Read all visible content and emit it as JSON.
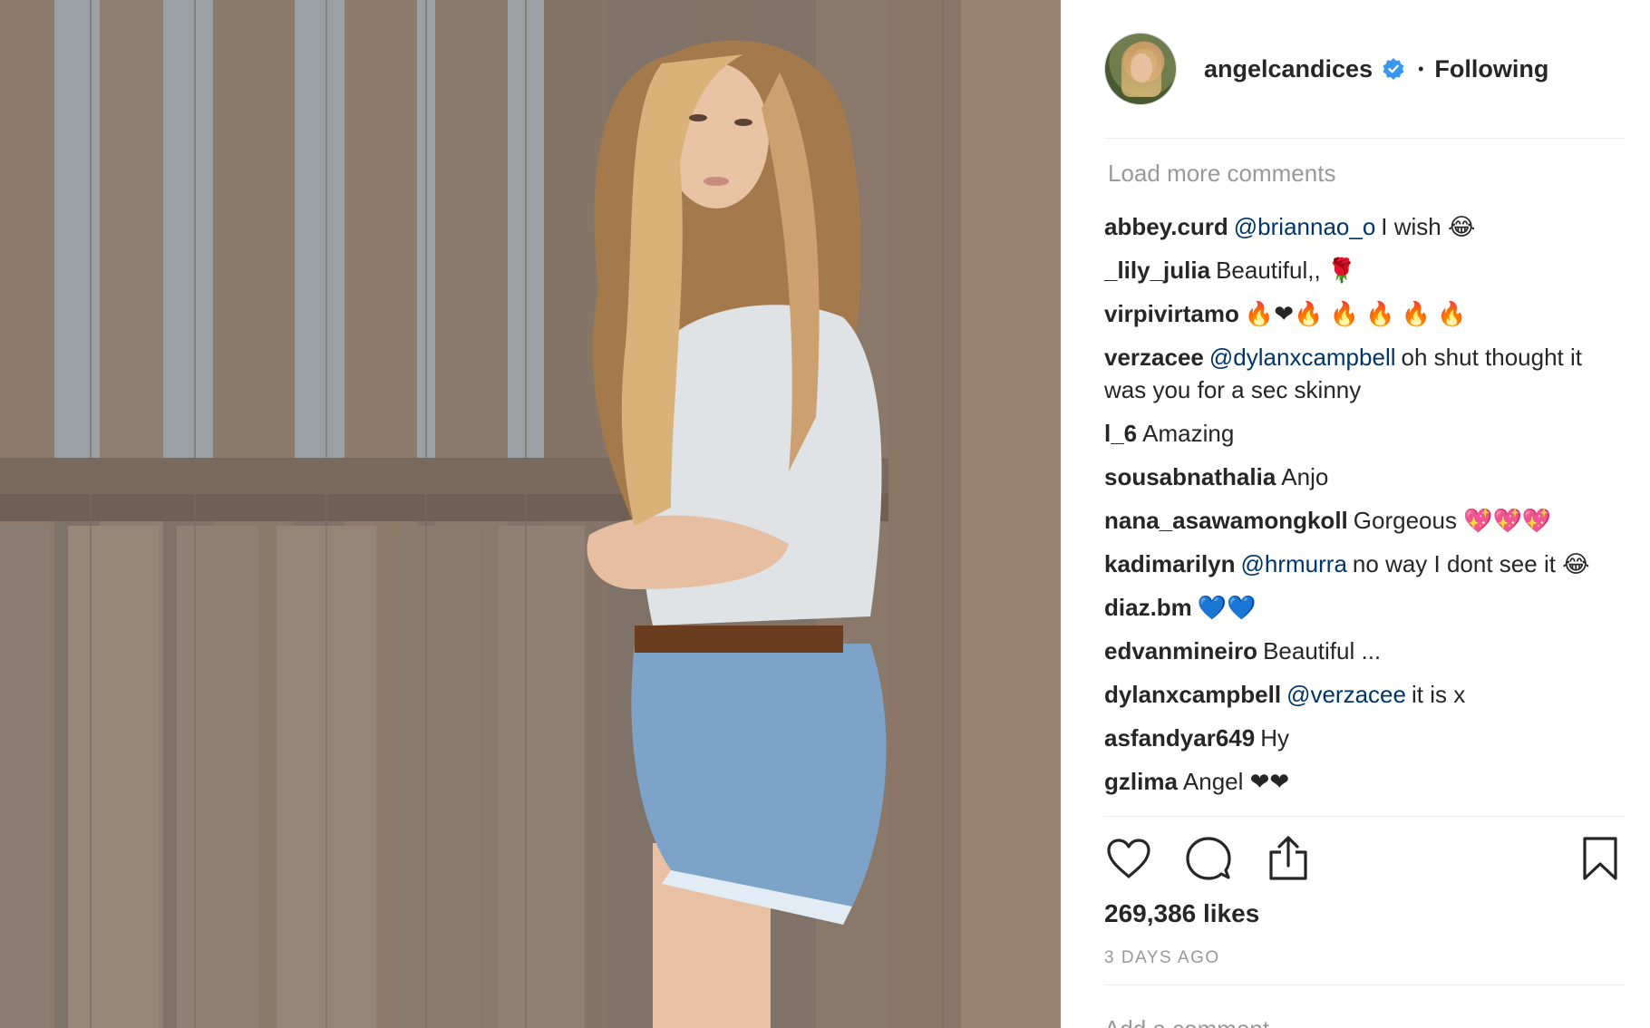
{
  "post": {
    "username": "angelcandices",
    "separator": "•",
    "follow_status": "Following",
    "load_more": "Load more comments",
    "likes": "269,386 likes",
    "time_ago": "3 DAYS AGO",
    "add_comment_placeholder": "Add a comment..."
  },
  "comments": [
    {
      "user": "abbey.curd",
      "mention": "@briannao_o",
      "text": "I wish 😂"
    },
    {
      "user": "_lily_julia",
      "mention": "",
      "text": "Beautiful,, 🌹"
    },
    {
      "user": "virpivirtamo",
      "mention": "",
      "text": "🔥❤🔥 🔥 🔥 🔥 🔥"
    },
    {
      "user": "verzacee",
      "mention": "@dylanxcampbell",
      "text": "oh shut thought it was you for a sec skinny"
    },
    {
      "user": "l_6",
      "mention": "",
      "text": "Amazing"
    },
    {
      "user": "sousabnathalia",
      "mention": "",
      "text": "Anjo"
    },
    {
      "user": "nana_asawamongkoll",
      "mention": "",
      "text": "Gorgeous 💖💖💖"
    },
    {
      "user": "kadimarilyn",
      "mention": "@hrmurra",
      "text": "no way I dont see it 😂"
    },
    {
      "user": "diaz.bm",
      "mention": "",
      "text": "💙💙"
    },
    {
      "user": "edvanmineiro",
      "mention": "",
      "text": "Beautiful ..."
    },
    {
      "user": "dylanxcampbell",
      "mention": "@verzacee",
      "text": "it is x"
    },
    {
      "user": "asfandyar649",
      "mention": "",
      "text": "Hy"
    },
    {
      "user": "gzlima",
      "mention": "",
      "text": "Angel ❤❤"
    }
  ],
  "icons": {
    "verified": "verified-badge-icon",
    "like": "heart-icon",
    "comment": "comment-bubble-icon",
    "share": "share-icon",
    "save": "bookmark-icon"
  },
  "colors": {
    "verified_blue": "#3897f0",
    "mention": "#003569",
    "muted": "#999999",
    "text": "#262626"
  }
}
